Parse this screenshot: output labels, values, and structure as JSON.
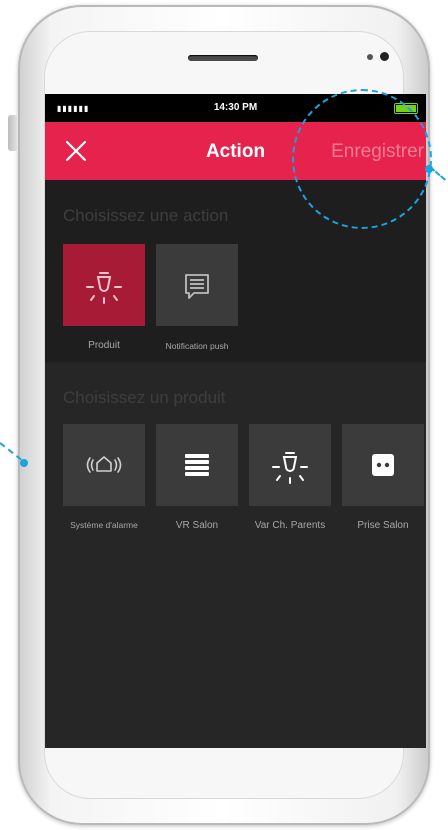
{
  "status_bar": {
    "signal": "▮▮▮▮▮▮",
    "time": "14:30 PM"
  },
  "header": {
    "title": "Action",
    "close_icon": "close-icon",
    "save_label": "Enregistrer"
  },
  "actions": {
    "title": "Choisissez une action",
    "items": [
      {
        "label": "Produit",
        "icon": "light-bulb-icon",
        "selected": true
      },
      {
        "label": "Notification push",
        "icon": "message-icon",
        "selected": false
      }
    ]
  },
  "products": {
    "title": "Choisissez un produit",
    "items": [
      {
        "label": "Système d'alarme",
        "icon": "alarm-home-icon"
      },
      {
        "label": "VR Salon",
        "icon": "roller-shutter-icon"
      },
      {
        "label": "Var Ch. Parents",
        "icon": "light-bulb-icon"
      },
      {
        "label": "Prise Salon",
        "icon": "power-outlet-icon"
      }
    ]
  },
  "colors": {
    "accent": "#e5234d",
    "selected_tile": "#a81b37",
    "tile": "#3b3b3b",
    "annotation": "#1aa3dc"
  }
}
